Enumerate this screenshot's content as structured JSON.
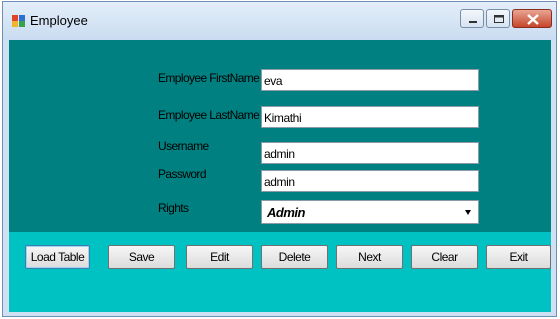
{
  "window": {
    "title": "Employee",
    "icons": {
      "app": "form-icon",
      "minimize": "minimize-icon",
      "maximize": "maximize-icon",
      "close": "close-icon"
    }
  },
  "form": {
    "first_name": {
      "label": "Employee FirstName",
      "value": "eva"
    },
    "last_name": {
      "label": "Employee LastName",
      "value": "Kimathi"
    },
    "username": {
      "label": "Username",
      "value": "admin"
    },
    "password": {
      "label": "Password",
      "value": "admin"
    },
    "rights": {
      "label": "Rights",
      "value": "Admin"
    }
  },
  "buttons": {
    "load_table": "Load Table",
    "save": "Save",
    "edit": "Edit",
    "delete": "Delete",
    "next": "Next",
    "clear": "Clear",
    "exit": "Exit"
  },
  "colors": {
    "form_background": "#008080",
    "button_strip": "#00c2c2"
  }
}
